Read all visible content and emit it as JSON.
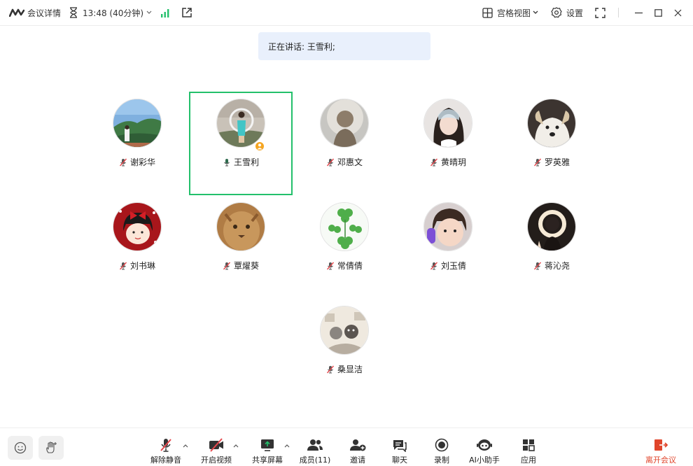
{
  "topbar": {
    "meeting_details": "会议详情",
    "timer": "13:48 (40分钟)",
    "view_mode": "宫格视图",
    "settings": "设置"
  },
  "speaking": {
    "text": "正在讲话: 王雪利;"
  },
  "participants": [
    {
      "name": "谢彩华",
      "muted": true
    },
    {
      "name": "王雪利",
      "muted": false,
      "speaking": true,
      "host": true
    },
    {
      "name": "邓惠文",
      "muted": true
    },
    {
      "name": "黄晴玥",
      "muted": true
    },
    {
      "name": "罗英雅",
      "muted": true
    },
    {
      "name": "刘书琳",
      "muted": true
    },
    {
      "name": "覃燿葵",
      "muted": true
    },
    {
      "name": "常倩倩",
      "muted": true
    },
    {
      "name": "刘玉倩",
      "muted": true
    },
    {
      "name": "蒋沁尧",
      "muted": true
    },
    {
      "name": "桑显洁",
      "muted": true
    }
  ],
  "toolbar": {
    "unmute": "解除静音",
    "start_video": "开启视频",
    "share_screen": "共享屏幕",
    "members": "成员(11)",
    "invite": "邀请",
    "chat": "聊天",
    "record": "录制",
    "ai_assistant": "AI小助手",
    "apps": "应用",
    "leave": "离开会议"
  },
  "colors": {
    "speaking_border": "#23c06b",
    "speaking_banner_bg": "#e9f0fc",
    "signal": "#23c06b",
    "muted_red": "#e5484d",
    "leave_red": "#e0452b",
    "host_badge": "#f5a623"
  }
}
